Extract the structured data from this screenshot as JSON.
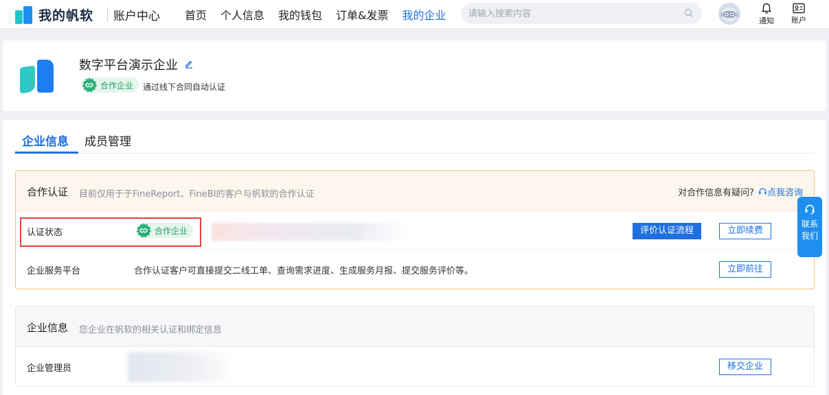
{
  "header": {
    "brand": "我的帆软",
    "subtitle": "账户中心",
    "nav": [
      {
        "label": "首页",
        "active": false
      },
      {
        "label": "个人信息",
        "active": false
      },
      {
        "label": "我的钱包",
        "active": false
      },
      {
        "label": "订单&发票",
        "active": false
      },
      {
        "label": "我的企业",
        "active": true
      }
    ],
    "search_placeholder": "请输入搜索内容",
    "notify_label": "通知",
    "account_label": "账户"
  },
  "company": {
    "name": "数字平台演示企业",
    "badge_label": "合作企业",
    "badge_note": "通过线下合同自动认证"
  },
  "tabs": [
    {
      "label": "企业信息",
      "active": true
    },
    {
      "label": "成员管理",
      "active": false
    }
  ],
  "partner_section": {
    "title": "合作认证",
    "desc": "目前仅用于于FineReport、FineBI的客户与帆软的合作认证",
    "question": "对合作信息有疑问?",
    "consult_link": "点我咨询",
    "rows": {
      "status_label": "认证状态",
      "status_badge": "合作企业",
      "evaluate_button": "评价认证流程",
      "renew_button": "立即续费",
      "service_label": "企业服务平台",
      "service_text": "合作认证客户可直接提交二线工单、查询需求进度、生成服务月报、提交服务评价等。",
      "goto_button": "立即前往"
    }
  },
  "info_section": {
    "title": "企业信息",
    "desc": "您企业在帆软的相关认证和绑定信息",
    "admin_label": "企业管理员",
    "transfer_button": "移交企业"
  },
  "float_contact": {
    "line1": "联系",
    "line2": "我们"
  },
  "colors": {
    "primary": "#1e6fe0",
    "badge_green": "#26a269",
    "highlight_red": "#e0403a",
    "partner_border": "#f3c27e"
  }
}
